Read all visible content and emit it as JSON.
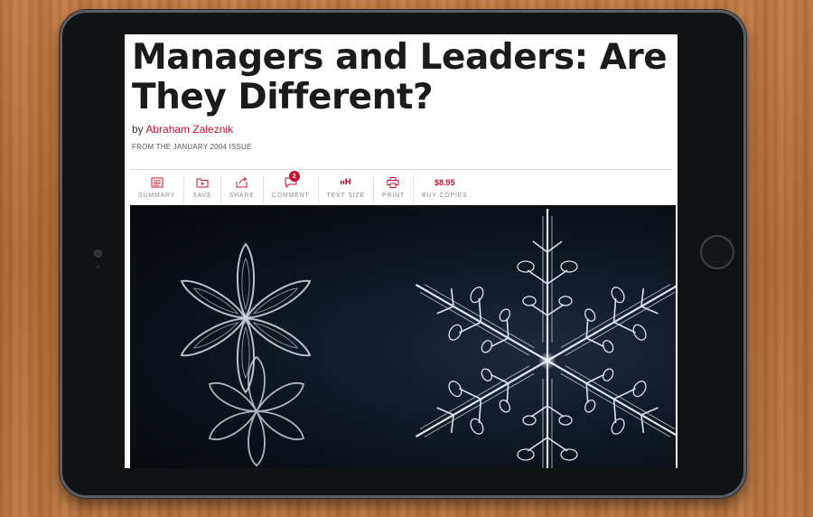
{
  "article": {
    "title": "Managers and Leaders: Are They Different?",
    "byline_prefix": "by",
    "author": "Abraham Zaleznik",
    "issue": "FROM THE JANUARY 2004 ISSUE"
  },
  "toolbar": {
    "items": [
      {
        "label": "SUMMARY",
        "icon": "summary-icon"
      },
      {
        "label": "SAVE",
        "icon": "folder-icon"
      },
      {
        "label": "SHARE",
        "icon": "share-icon"
      },
      {
        "label": "COMMENT",
        "icon": "comment-icon",
        "badge": "2"
      },
      {
        "label": "TEXT SIZE",
        "icon": "text-size-icon"
      },
      {
        "label": "PRINT",
        "icon": "printer-icon"
      },
      {
        "label": "BUY COPIES",
        "price": "$8.95"
      }
    ]
  },
  "colors": {
    "accent": "#c8102e",
    "title": "#1b1b1b",
    "hero_bg": "#0d141c",
    "bezel": "#111214"
  }
}
